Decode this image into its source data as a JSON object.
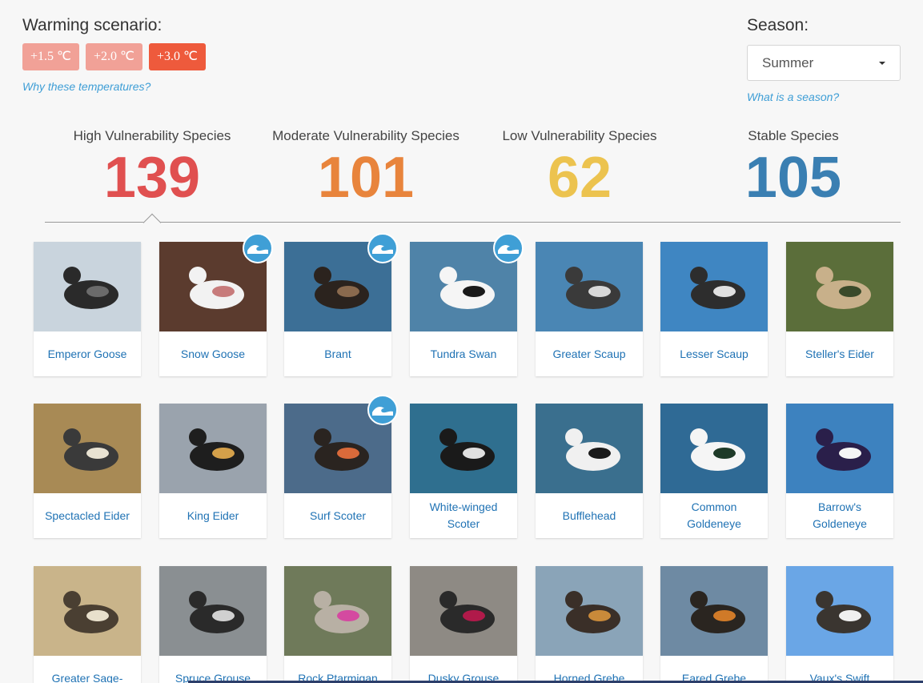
{
  "warming": {
    "title": "Warming scenario:",
    "options": [
      "+1.5 ℃",
      "+2.0 ℃",
      "+3.0 ℃"
    ],
    "selected_index": 2,
    "help_link": "Why these temperatures?"
  },
  "season": {
    "title": "Season:",
    "selected": "Summer",
    "help_link": "What is a season?"
  },
  "stats": [
    {
      "label": "High Vulnerability Species",
      "count": "139",
      "color": "#e05050"
    },
    {
      "label": "Moderate Vulnerability Species",
      "count": "101",
      "color": "#e8843c"
    },
    {
      "label": "Low Vulnerability Species",
      "count": "62",
      "color": "#ecc34f"
    },
    {
      "label": "Stable Species",
      "count": "105",
      "color": "#3a7fb2"
    }
  ],
  "species": [
    {
      "name": "Emperor Goose",
      "wave": false
    },
    {
      "name": "Snow Goose",
      "wave": true
    },
    {
      "name": "Brant",
      "wave": true
    },
    {
      "name": "Tundra Swan",
      "wave": true
    },
    {
      "name": "Greater Scaup",
      "wave": false
    },
    {
      "name": "Lesser Scaup",
      "wave": false
    },
    {
      "name": "Steller's Eider",
      "wave": false
    },
    {
      "name": "Spectacled Eider",
      "wave": false
    },
    {
      "name": "King Eider",
      "wave": false
    },
    {
      "name": "Surf Scoter",
      "wave": true
    },
    {
      "name": "White-winged Scoter",
      "wave": false
    },
    {
      "name": "Bufflehead",
      "wave": false
    },
    {
      "name": "Common Goldeneye",
      "wave": false
    },
    {
      "name": "Barrow's Goldeneye",
      "wave": false
    },
    {
      "name": "Greater Sage-",
      "wave": false
    },
    {
      "name": "Spruce Grouse",
      "wave": false
    },
    {
      "name": "Rock Ptarmigan",
      "wave": false
    },
    {
      "name": "Dusky Grouse",
      "wave": false
    },
    {
      "name": "Horned Grebe",
      "wave": false
    },
    {
      "name": "Eared Grebe",
      "wave": false
    },
    {
      "name": "Vaux's Swift",
      "wave": false
    }
  ],
  "photo_palettes": [
    [
      "#c9d4dd",
      "#2a2a2a",
      "#6b6b6b"
    ],
    [
      "#5b3b2e",
      "#f2f2f2",
      "#c77b7b"
    ],
    [
      "#3c6f96",
      "#2b231e",
      "#8a6a4e"
    ],
    [
      "#4f83a8",
      "#f5f5f5",
      "#1a1a1a"
    ],
    [
      "#4a86b4",
      "#3a3a3a",
      "#d8d8d8"
    ],
    [
      "#3f86c2",
      "#2d2d2d",
      "#e0e0e0"
    ],
    [
      "#5b6e3a",
      "#c8b08a",
      "#3a4a2a"
    ],
    [
      "#a88a55",
      "#3a3a3a",
      "#e8e2d2"
    ],
    [
      "#9aa3ad",
      "#1e1e1e",
      "#d4a04a"
    ],
    [
      "#4c6b8a",
      "#2a2420",
      "#d96a3a"
    ],
    [
      "#2f6f8f",
      "#1a1a1a",
      "#e0e0e0"
    ],
    [
      "#3a6f8e",
      "#f0f0f0",
      "#1a1a1a"
    ],
    [
      "#2f6a95",
      "#f5f5f5",
      "#1e3a28"
    ],
    [
      "#3d82bf",
      "#2a1f4a",
      "#f5f5f5"
    ],
    [
      "#c9b48a",
      "#4a3f32",
      "#e8e0cc"
    ],
    [
      "#8a8f92",
      "#2a2a2a",
      "#d0d0d0"
    ],
    [
      "#6f7a5a",
      "#b8b0a4",
      "#d44aa0"
    ],
    [
      "#8e8a84",
      "#2a2a2a",
      "#b01a4a"
    ],
    [
      "#8aa4b8",
      "#3a2f28",
      "#c98a3a"
    ],
    [
      "#6e8aa3",
      "#2a2520",
      "#d07a28"
    ],
    [
      "#6aa6e6",
      "#3a3530",
      "#f0f0f0"
    ]
  ]
}
